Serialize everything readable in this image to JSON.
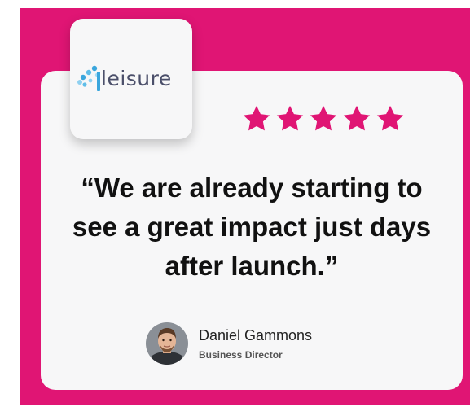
{
  "brand": {
    "logo_text": "leisure"
  },
  "rating": {
    "stars": 5,
    "max": 5
  },
  "testimonial": {
    "quote": "“We are already starting to see a great impact just days after launch.”"
  },
  "author": {
    "name": "Daniel Gammons",
    "title": "Business Director"
  },
  "colors": {
    "accent": "#e01574",
    "card": "#f7f7f8",
    "logo_blue": "#3aa6dd",
    "text": "#111111"
  },
  "icons": [
    "leisure-logo-mark-icon",
    "star-icon",
    "author-avatar"
  ]
}
